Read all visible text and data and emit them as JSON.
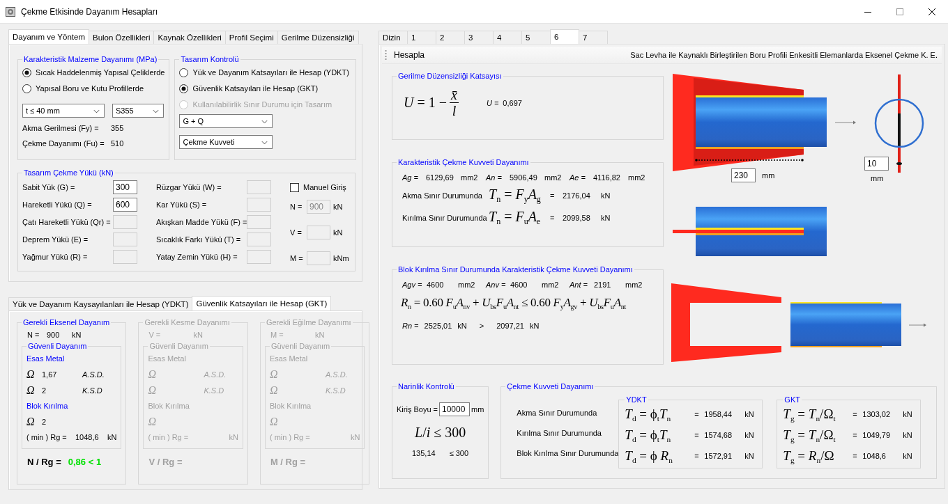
{
  "window": {
    "title": "Çekme Etkisinde Dayanım Hesapları"
  },
  "left_tabs": [
    {
      "label": "Dayanım ve Yöntem",
      "selected": true
    },
    {
      "label": "Bulon Özellikleri",
      "selected": false
    },
    {
      "label": "Kaynak Özellikleri",
      "selected": false
    },
    {
      "label": "Profil Seçimi",
      "selected": false
    },
    {
      "label": "Gerilme Düzensizliği",
      "selected": false
    }
  ],
  "material": {
    "title": "Karakteristik Malzeme Dayanımı (MPa)",
    "options": [
      {
        "label": "Sıcak Haddelenmiş Yapısal Çeliklerde",
        "selected": true
      },
      {
        "label": "Yapısal Boru ve Kutu Profillerde",
        "selected": false
      }
    ],
    "thickness": "t ≤ 40 mm",
    "grade": "S355",
    "values": [
      {
        "label": "Akma Gerilmesi (Fy) =",
        "value": "355"
      },
      {
        "label": "Çekme Dayanımı (Fu) =",
        "value": "510"
      }
    ]
  },
  "design": {
    "title": "Tasarım Kontrolü",
    "options": [
      {
        "label": "Yük ve Dayanım Katsayıları ile Hesap (YDKT)",
        "selected": false,
        "disabled": false
      },
      {
        "label": "Güvenlik Katsayıları ile Hesap (GKT)",
        "selected": true,
        "disabled": false
      },
      {
        "label": "Kullanılabilirlik Sınır Durumu için Tasarım",
        "selected": false,
        "disabled": true
      }
    ],
    "combination": "G + Q",
    "force": "Çekme Kuvveti"
  },
  "loads": {
    "title": "Tasarım Çekme Yükü (kN)",
    "left": [
      {
        "label": "Sabit Yük (G) =",
        "value": "300",
        "disabled": false
      },
      {
        "label": "Hareketli Yükü (Q) =",
        "value": "600",
        "disabled": false
      },
      {
        "label": "Çatı Hareketli Yükü (Qr) =",
        "disabled": true
      },
      {
        "label": "Deprem Yükü (E) =",
        "disabled": true
      },
      {
        "label": "Yağmur Yükü (R) =",
        "disabled": true
      }
    ],
    "right": [
      {
        "label": "Rüzgar Yükü (W) =",
        "disabled": true
      },
      {
        "label": "Kar Yükü (S) =",
        "disabled": true
      },
      {
        "label": "Akışkan Madde Yükü (F) =",
        "disabled": true
      },
      {
        "label": "Sıcaklık Farkı Yükü (T) =",
        "disabled": true
      },
      {
        "label": "Yatay Zemin Yükü (H) =",
        "disabled": true
      }
    ],
    "manual": {
      "label": "Manuel Giriş",
      "checked": false
    },
    "manual_fields": [
      {
        "label": "N =",
        "value": "900",
        "unit": "kN",
        "disabled": true
      },
      {
        "label": "V =",
        "unit": "kN",
        "disabled": true
      },
      {
        "label": "M =",
        "unit": "kNm",
        "disabled": true
      }
    ]
  },
  "method_tabs": [
    {
      "label": "Yük ve Dayanım Kaysayılanları ile Hesap (YDKT)",
      "selected": false
    },
    {
      "label": "Güvenlik Katsayıları ile Hesap (GKT)",
      "selected": true
    }
  ],
  "checks": [
    {
      "title": "Gerekli Eksenel Dayanım",
      "disabled": false,
      "demand": {
        "label": "N =",
        "value": "900",
        "unit": "kN"
      },
      "safe_title": "Güvenli Dayanım",
      "base_title": "Esas Metal",
      "omegas": [
        {
          "symbol": "Ω",
          "value": "1,67",
          "method": "A.S.D."
        },
        {
          "symbol": "Ω",
          "value": "2",
          "method": "K.S.D"
        }
      ],
      "block_title": "Blok Kırılma",
      "block_omega": {
        "symbol": "Ω",
        "value": "2"
      },
      "rg": {
        "label": "( min ) Rg =",
        "value": "1048,6",
        "unit": "kN"
      },
      "ratio": {
        "label": "N / Rg =",
        "value": "0,86 < 1"
      }
    },
    {
      "title": "Gerekli Kesme Dayanımı",
      "disabled": true,
      "demand": {
        "label": "V =",
        "unit": "kN"
      },
      "safe_title": "Güvenli Dayanım",
      "base_title": "Esas Metal",
      "omegas": [
        {
          "symbol": "Ω",
          "method": "A.S.D."
        },
        {
          "symbol": "Ω",
          "method": "K.S.D"
        }
      ],
      "block_title": "Blok Kırılma",
      "block_omega": {
        "symbol": "Ω"
      },
      "rg": {
        "label": "( min ) Rg =",
        "unit": "kN"
      },
      "ratio": {
        "label": "V / Rg ="
      }
    },
    {
      "title": "Gerekli Eğilme Dayanımı",
      "disabled": true,
      "demand": {
        "label": "M =",
        "unit": "kN"
      },
      "safe_title": "Güvenli Dayanım",
      "base_title": "Esas Metal",
      "omegas": [
        {
          "symbol": "Ω",
          "method": "A.S.D."
        },
        {
          "symbol": "Ω",
          "method": "K.S.D"
        }
      ],
      "block_title": "Blok Kırılma",
      "block_omega": {
        "symbol": "Ω"
      },
      "rg": {
        "label": "( min ) Rg =",
        "unit": "kN"
      },
      "ratio": {
        "label": "M / Rg ="
      }
    }
  ],
  "right_tabs": [
    {
      "label": "Dizin",
      "selected": false
    },
    {
      "label": "1",
      "selected": false
    },
    {
      "label": "2",
      "selected": false
    },
    {
      "label": "3",
      "selected": false
    },
    {
      "label": "4",
      "selected": false
    },
    {
      "label": "5",
      "selected": false
    },
    {
      "label": "6",
      "selected": true
    },
    {
      "label": "7",
      "selected": false
    }
  ],
  "toolbar": {
    "button": "Hesapla",
    "title": "Sac Levha ile Kaynaklı Birleştirilen Boru Profili Enkesitli Elemanlarda Eksenel Çekme K. E."
  },
  "irregularity": {
    "title": "Gerilme Düzensizliği Katsayısı",
    "formula": {
      "lhs": "*U* = 1 −",
      "num": "x̄",
      "den": "l"
    },
    "result_label": "U =",
    "result": "0,697"
  },
  "tension": {
    "title": "Karakteristik Çekme Kuvveti Dayanımı",
    "areas": [
      {
        "label": "Ag =",
        "value": "6129,69",
        "unit": "mm2"
      },
      {
        "label": "An =",
        "value": "5906,49",
        "unit": "mm2"
      },
      {
        "label": "Ae =",
        "value": "4116,82",
        "unit": "mm2"
      }
    ],
    "rows": [
      {
        "label": "Akma Sınır Durumunda",
        "formula": "*T*$_{n}$ = *F*$_{y}$*A*$_{g}$",
        "eq": "=",
        "value": "2176,04",
        "unit": "kN"
      },
      {
        "label": "Kırılma Sınır Durumunda",
        "formula": "*T*$_{n}$ = *F*$_{u}$*A*$_{e}$",
        "eq": "=",
        "value": "2099,58",
        "unit": "kN"
      }
    ]
  },
  "block": {
    "title": "Blok Kırılma Sınır Durumunda Karakteristik Çekme Kuvveti Dayanımı",
    "areas": [
      {
        "label": "Agv =",
        "value": "4600",
        "unit": "mm2"
      },
      {
        "label": "Anv =",
        "value": "4600",
        "unit": "mm2"
      },
      {
        "label": "Ant =",
        "value": "2191",
        "unit": "mm2"
      }
    ],
    "formula": "*R*$_{n}$ = 0.60 *F*$_{u}$*A*$_{nv}$ + *U*$_{bs}$*F*$_{u}$*A*$_{nt}$ ≤ 0.60 *F*$_{y}$*A*$_{gv}$ + *U*$_{bs}$*F*$_{u}$*A*$_{nt}$",
    "result": {
      "label": "Rn =",
      "value": "2525,01",
      "unit": "kN",
      "op": ">",
      "limit": "2097,21",
      "limit_unit": "kN"
    }
  },
  "drawing": {
    "weld_length": "230",
    "weld_unit": "mm",
    "plate_thickness": "10",
    "plate_unit": "mm"
  },
  "slenderness": {
    "title": "Narinlik Kontrolü",
    "length_label": "Kiriş Boyu =",
    "length": "10000",
    "length_unit": "mm",
    "formula": "*L*/*i* ≤ 300",
    "ratio": "135,14",
    "limit": "≤ 300"
  },
  "capacity": {
    "title": "Çekme Kuvveti Dayanımı",
    "labels": [
      "Akma Sınır Durumunda",
      "Kırılma Sınır Durumunda",
      "Blok Kırılma Sınır Durumunda"
    ],
    "groups": [
      {
        "title": "YDKT",
        "rows": [
          {
            "formula": "*T*$_{d}$ = ϕ$_{t}$*T*$_{n}$",
            "eq": "=",
            "value": "1958,44",
            "unit": "kN"
          },
          {
            "formula": "*T*$_{d}$ = ϕ$_{t}$*T*$_{n}$",
            "eq": "=",
            "value": "1574,68",
            "unit": "kN"
          },
          {
            "formula": "*T*$_{d}$ = ϕ *R*$_{n}$",
            "eq": "=",
            "value": "1572,91",
            "unit": "kN"
          }
        ]
      },
      {
        "title": "GKT",
        "rows": [
          {
            "formula": "*T*$_{g}$ = *T*$_{n}$/Ω$_{t}$",
            "eq": "=",
            "value": "1303,02",
            "unit": "kN"
          },
          {
            "formula": "*T*$_{g}$ = *T*$_{n}$/Ω$_{t}$",
            "eq": "=",
            "value": "1049,79",
            "unit": "kN"
          },
          {
            "formula": "*T*$_{g}$ = *R*$_{n}$/Ω",
            "eq": "=",
            "value": "1048,6",
            "unit": "kN"
          }
        ]
      }
    ]
  }
}
